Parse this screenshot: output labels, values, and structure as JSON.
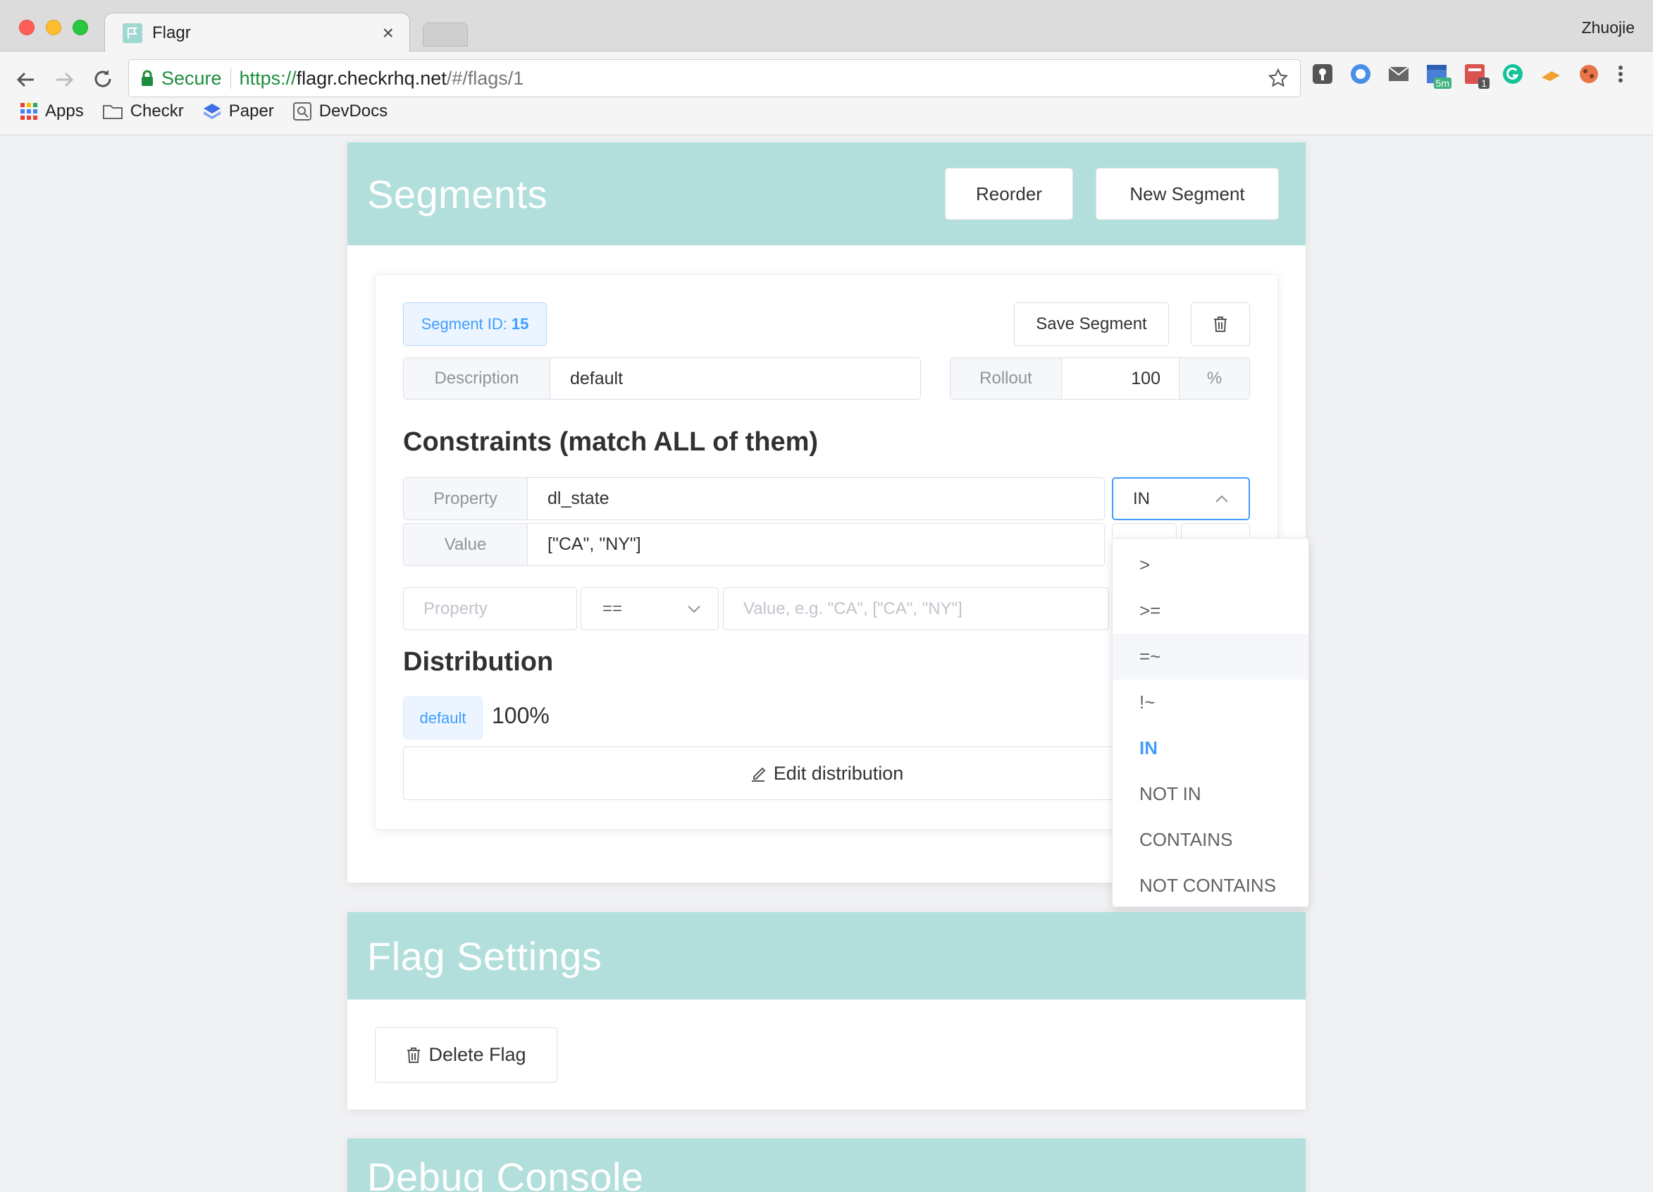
{
  "browser": {
    "tab_title": "Flagr",
    "tab_close": "×",
    "user": "Zhuojie",
    "secure_label": "Secure",
    "url_scheme": "https://",
    "url_host": "flagr.checkrhq.net",
    "url_path": "/#/flags/1",
    "bookmarks": [
      "Apps",
      "Checkr",
      "Paper",
      "DevDocs"
    ],
    "ext_badges": [
      "5m",
      "1"
    ]
  },
  "segments": {
    "title": "Segments",
    "reorder_label": "Reorder",
    "new_segment_label": "New Segment",
    "segment": {
      "id_label": "Segment ID:",
      "id_value": "15",
      "save_label": "Save Segment",
      "description_label": "Description",
      "description_value": "default",
      "rollout_label": "Rollout",
      "rollout_value": "100",
      "rollout_unit": "%",
      "constraints_title": "Constraints (match ALL of them)",
      "constraint": {
        "property_label": "Property",
        "property_value": "dl_state",
        "operator": "IN",
        "value_label": "Value",
        "value_value": "[\"CA\", \"NY\"]"
      },
      "new_constraint": {
        "property_placeholder": "Property",
        "operator": "==",
        "value_placeholder": "Value, e.g. \"CA\", [\"CA\", \"NY\"]"
      },
      "distribution_title": "Distribution",
      "distribution_tag": "default",
      "distribution_percent": "100%",
      "edit_distribution_label": "Edit distribution"
    },
    "operator_dropdown": [
      ">",
      ">=",
      "=~",
      "!~",
      "IN",
      "NOT IN",
      "CONTAINS",
      "NOT CONTAINS"
    ],
    "operator_selected": "IN",
    "operator_hovered": "=~"
  },
  "flag_settings": {
    "title": "Flag Settings",
    "delete_flag_label": "Delete Flag"
  },
  "debug_console": {
    "title": "Debug Console"
  },
  "colors": {
    "header": "#b2dfdb",
    "accent": "#409eff",
    "secure_green": "#1e8e3e"
  }
}
